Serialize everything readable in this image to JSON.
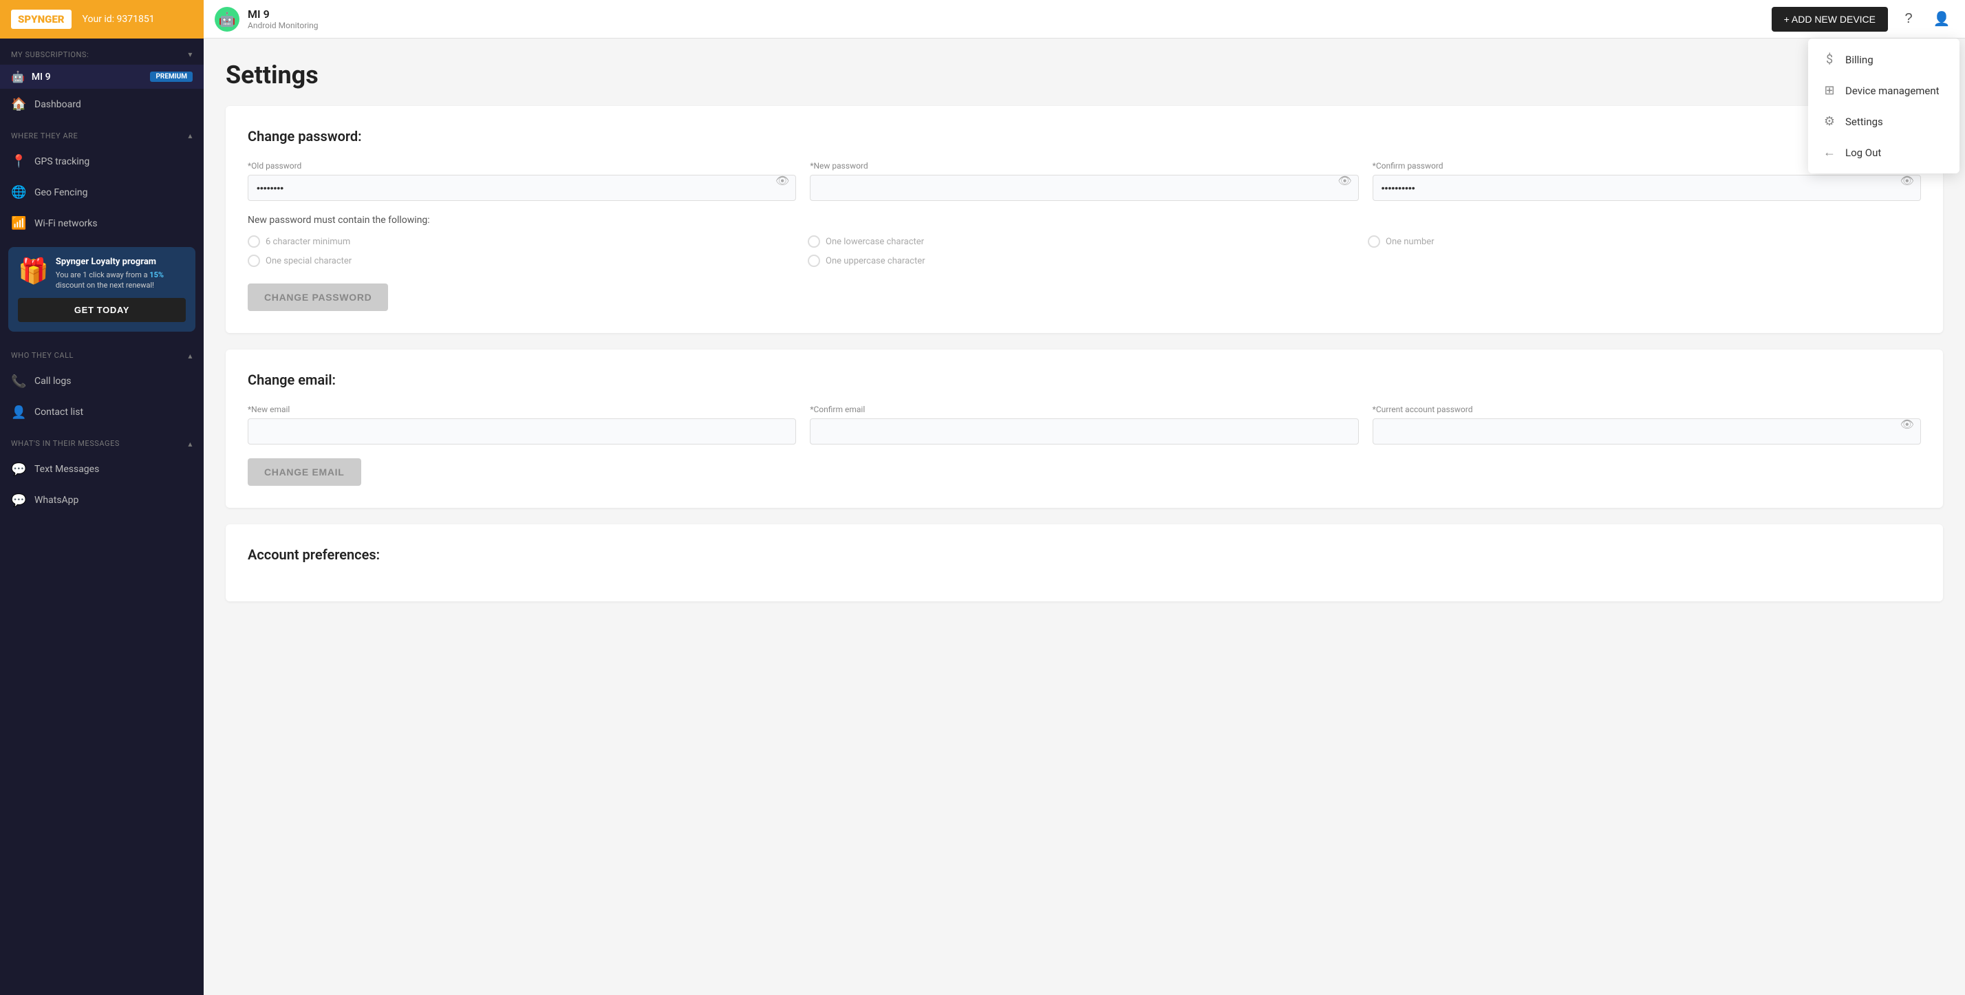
{
  "header": {
    "logo": "SPYNGER",
    "user_id_label": "Your id: 9371851",
    "add_device_label": "+ ADD NEW DEVICE",
    "device_name": "MI 9",
    "device_sub": "Android Monitoring"
  },
  "sidebar": {
    "my_subscriptions": "MY SUBSCRIPTIONS:",
    "device_name": "MI 9",
    "premium_badge": "PREMIUM",
    "where_they_are": "WHERE THEY ARE",
    "nav_items_location": [
      {
        "label": "Dashboard",
        "icon": "🏠"
      },
      {
        "label": "GPS tracking",
        "icon": "📍"
      },
      {
        "label": "Geo Fencing",
        "icon": "🌐"
      },
      {
        "label": "Wi-Fi networks",
        "icon": "📶"
      }
    ],
    "loyalty": {
      "title": "Spynger Loyalty program",
      "desc_prefix": "You are 1 click away from a ",
      "discount": "15%",
      "desc_suffix": " discount on the next renewal!",
      "btn_label": "GET TODAY"
    },
    "who_they_call": "WHO THEY CALL",
    "nav_items_calls": [
      {
        "label": "Call logs",
        "icon": "📞"
      },
      {
        "label": "Contact list",
        "icon": "👤"
      }
    ],
    "whats_in_messages": "WHAT'S IN THEIR MESSAGES",
    "nav_items_messages": [
      {
        "label": "Text Messages",
        "icon": "💬"
      },
      {
        "label": "WhatsApp",
        "icon": "💬"
      }
    ]
  },
  "main": {
    "page_title": "Settings",
    "change_password": {
      "section_title": "Change password:",
      "old_password_label": "*Old password",
      "old_password_value": "••••••••",
      "new_password_label": "*New password",
      "confirm_password_label": "*Confirm password",
      "confirm_password_value": "••••••••••",
      "requirements_title": "New password must contain the following:",
      "requirements": [
        "6 character minimum",
        "One lowercase character",
        "One number",
        "One special character",
        "One uppercase character"
      ],
      "change_btn": "CHANGE PASSWORD"
    },
    "change_email": {
      "section_title": "Change email:",
      "new_email_label": "*New email",
      "confirm_email_label": "*Confirm email",
      "current_password_label": "*Current account password",
      "change_btn": "CHANGE EMAIL"
    },
    "account_preferences": {
      "section_title": "Account preferences:"
    }
  },
  "dropdown": {
    "items": [
      {
        "label": "Billing",
        "icon": "$"
      },
      {
        "label": "Device management",
        "icon": "⊞"
      },
      {
        "label": "Settings",
        "icon": "⚙"
      },
      {
        "label": "Log Out",
        "icon": "←"
      }
    ]
  }
}
